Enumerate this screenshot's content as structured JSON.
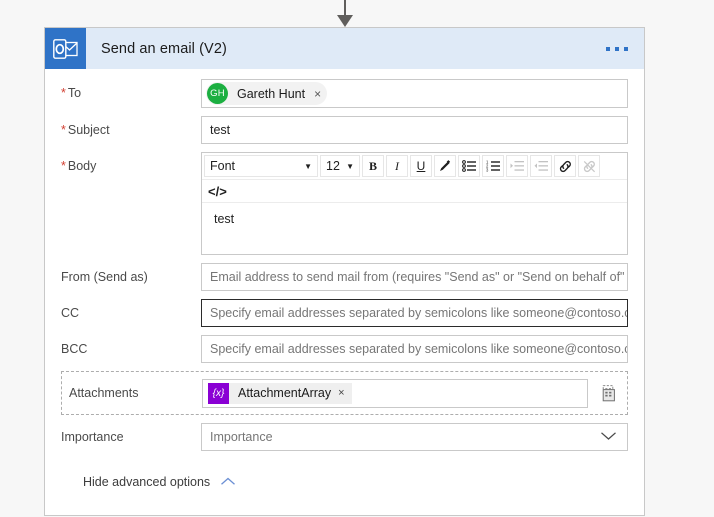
{
  "connector": {
    "icon": "down-arrow-icon"
  },
  "card": {
    "title": "Send an email (V2)",
    "app_icon": "outlook-icon",
    "header_bg": "#dfeaf7",
    "icon_tile_bg": "#2f73c7",
    "menu": {
      "icon": "ellipsis-icon",
      "dots": 3,
      "color": "#2f73c7"
    }
  },
  "fields": {
    "to": {
      "label": "To",
      "required": true,
      "recipient": {
        "initials": "GH",
        "name": "Gareth Hunt",
        "avatar_color": "#1caf41",
        "remove_icon": "×"
      }
    },
    "subject": {
      "label": "Subject",
      "required": true,
      "value": "test"
    },
    "body": {
      "label": "Body",
      "required": true,
      "value": "test",
      "toolbar": {
        "font_name": "Font",
        "font_size": "12",
        "bold": "B",
        "italic": "I",
        "underline": "U",
        "text_color_icon": "pen-icon",
        "bulleted_list_icon": "bulleted-list-icon",
        "numbered_list_icon": "numbered-list-icon",
        "indent_increase_icon": "indent-increase-icon",
        "indent_decrease_icon": "indent-decrease-icon",
        "link_icon": "link-icon",
        "unlink_icon": "unlink-icon",
        "code_view": "</>"
      }
    },
    "from": {
      "label": "From (Send as)",
      "required": false,
      "placeholder": "Email address to send mail from (requires \"Send as\" or \"Send on behalf of\" permissions)"
    },
    "cc": {
      "label": "CC",
      "required": false,
      "focused": true,
      "placeholder": "Specify email addresses separated by semicolons like someone@contoso.com"
    },
    "bcc": {
      "label": "BCC",
      "required": false,
      "placeholder": "Specify email addresses separated by semicolons like someone@contoso.com"
    },
    "attachments": {
      "label": "Attachments",
      "required": false,
      "token": {
        "icon": "{x}",
        "icon_color": "#8a00d4",
        "label": "AttachmentArray",
        "remove_icon": "×"
      },
      "array_picker_icon": "grid-icon"
    },
    "importance": {
      "label": "Importance",
      "required": false,
      "placeholder": "Importance",
      "chevron_icon": "chevron-down-icon"
    }
  },
  "advanced_options": {
    "label": "Hide advanced options",
    "chevron_icon": "chevron-up-icon",
    "chevron_color": "#6b8fd4"
  }
}
